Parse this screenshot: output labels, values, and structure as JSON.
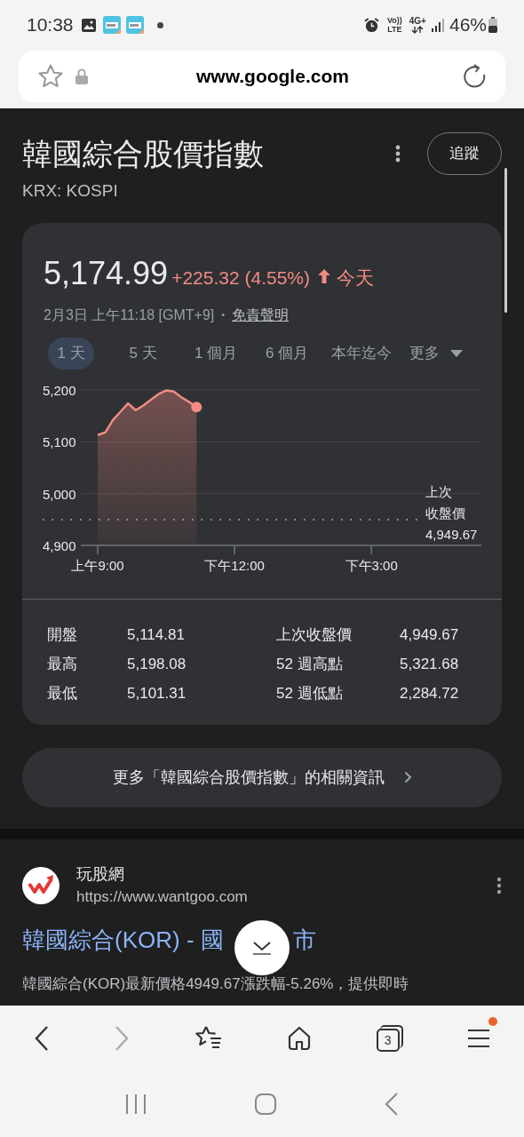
{
  "status_bar": {
    "time": "10:38",
    "network_top": "Vo))",
    "network_bottom": "LTE",
    "data_type": "4G+",
    "battery": "46%"
  },
  "address_bar": {
    "url": "www.google.com"
  },
  "stock": {
    "title": "韓國綜合股價指數",
    "follow_button": "追蹤",
    "ticker": "KRX: KOSPI",
    "price": "5,174.99",
    "change": "+225.32 (4.55%)",
    "period": "今天",
    "timestamp": "2月3日 上午11:18 [GMT+9]",
    "separator": "•",
    "disclaimer": "免責聲明",
    "ranges": [
      {
        "label": "1 天",
        "selected": true,
        "kind": "plain"
      },
      {
        "label": "5 天",
        "selected": false,
        "kind": "plain"
      },
      {
        "label": "1 個月",
        "selected": false,
        "kind": "plain"
      },
      {
        "label": "6 個月",
        "selected": false,
        "kind": "plain"
      },
      {
        "label": "本年迄今",
        "selected": false,
        "kind": "plain"
      },
      {
        "label": "更多",
        "selected": false,
        "kind": "dropdown"
      }
    ],
    "chart_data": {
      "type": "area",
      "categories": [
        "上午9:00",
        null,
        null,
        null,
        null,
        null,
        null,
        null,
        null,
        null,
        null,
        null,
        null,
        null,
        null,
        null,
        null,
        null,
        "下午12:00",
        null,
        null,
        null,
        null,
        null,
        null,
        null,
        null,
        null,
        null,
        null,
        null,
        null,
        null,
        null,
        null,
        null,
        "下午3:00",
        null,
        null,
        null,
        null,
        null,
        null,
        null,
        null,
        null,
        null,
        null,
        null,
        null,
        null
      ],
      "series": [
        {
          "color": "#f28b82",
          "values": [
            5113,
            5118,
            5142,
            5158,
            5174,
            5161,
            5170,
            5181,
            5192,
            5199,
            5197,
            5186,
            5177,
            5167,
            null,
            null,
            null,
            null,
            null,
            null,
            null,
            null,
            null,
            null,
            null,
            null,
            null,
            null,
            null,
            null,
            null,
            null,
            null,
            null,
            null,
            null,
            null,
            null,
            null,
            null,
            null,
            null,
            null,
            null,
            null,
            null,
            null,
            null,
            null,
            null,
            null
          ]
        }
      ],
      "ylim": [
        4900,
        5200
      ],
      "yticks": [
        {
          "value": 4900,
          "label": "4,900"
        },
        {
          "value": 5000,
          "label": "5,000"
        },
        {
          "value": 5100,
          "label": "5,100"
        },
        {
          "value": 5200,
          "label": "5,200"
        }
      ],
      "ref_lines": [
        {
          "axis": "y",
          "value": 4949.67
        }
      ],
      "annotations": [
        "上次",
        "收盤價",
        "4,949.67"
      ]
    },
    "stats": [
      [
        {
          "label": "開盤",
          "value": "5,114.81"
        },
        {
          "label": "上次收盤價",
          "value": "4,949.67"
        }
      ],
      [
        {
          "label": "最高",
          "value": "5,198.08"
        },
        {
          "label": "52 週高點",
          "value": "5,321.68"
        }
      ],
      [
        {
          "label": "最低",
          "value": "5,101.31"
        },
        {
          "label": "52 週低點",
          "value": "2,284.72"
        }
      ]
    ],
    "more_button": "更多「韓國綜合股價指數」的相關資訊"
  },
  "result": {
    "site_name": "玩股網",
    "url": "https://www.wantgoo.com",
    "title_visible_start": "韓國綜合(KOR) - 國",
    "title_visible_end": "市",
    "snippet": "韓國綜合(KOR)最新價格4949.67漲跌幅-5.26%，提供即時"
  },
  "bottom_bar": {
    "forward_disabled": true,
    "tab_count": "3",
    "menu_badge": true
  }
}
